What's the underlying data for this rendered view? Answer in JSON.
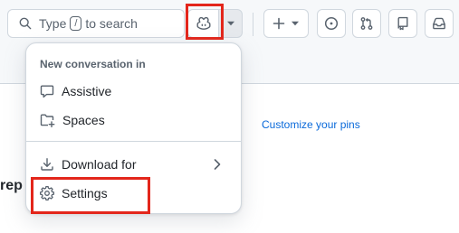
{
  "header": {
    "search": {
      "label_before": "Type",
      "slash_key": "/",
      "label_after": "to search"
    }
  },
  "page": {
    "customize_pins_link": "Customize your pins",
    "partial_heading": "rep"
  },
  "copilot_menu": {
    "heading": "New conversation in",
    "items": [
      {
        "label": "Assistive",
        "icon": "comment-icon"
      },
      {
        "label": "Spaces",
        "icon": "folder-plus-icon"
      }
    ],
    "secondary_items": [
      {
        "label": "Download for",
        "icon": "download-icon",
        "has_submenu": true
      },
      {
        "label": "Settings",
        "icon": "gear-icon"
      }
    ]
  },
  "colors": {
    "highlight": "#e3261b",
    "link": "#0969da"
  }
}
